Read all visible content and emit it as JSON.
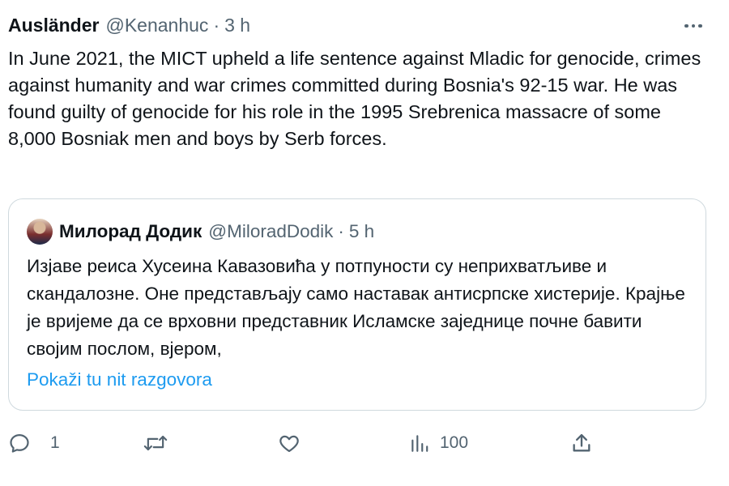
{
  "tweet": {
    "author_name": "Ausländer",
    "handle": "@Kenanhuc",
    "separator": "·",
    "time": "3 h",
    "text": "In June 2021, the MICT upheld a life sentence against Mladic for genocide, crimes against humanity and war crimes committed during Bosnia's 92-15 war. He was found guilty of genocide for his role in the 1995 Srebrenica massacre of some 8,000 Bosniak men and boys by Serb forces."
  },
  "quote": {
    "author_name": "Милорад Додик",
    "handle": "@MiloradDodik",
    "separator": "·",
    "time": "5 h",
    "text": "Изјаве реиса Хусеина Кавазовића у потпуности су неприхватљиве и скандалозне. Оне представљају само наставак антисрпске хистерије. Крајње је вријеме да се врховни представник Исламске заједнице почне бавити својим послом, вјером,",
    "show_thread_label": "Pokaži tu nit razgovora"
  },
  "actions": {
    "reply_count": "1",
    "views_count": "100"
  },
  "icons": {
    "more": "more-horizontal-icon",
    "reply": "reply-icon",
    "retweet": "retweet-icon",
    "like": "heart-icon",
    "views": "views-chart-icon",
    "share": "share-icon"
  },
  "colors": {
    "text": "#0f1419",
    "muted": "#536471",
    "link": "#1d9bf0",
    "border": "#cfd9de"
  }
}
